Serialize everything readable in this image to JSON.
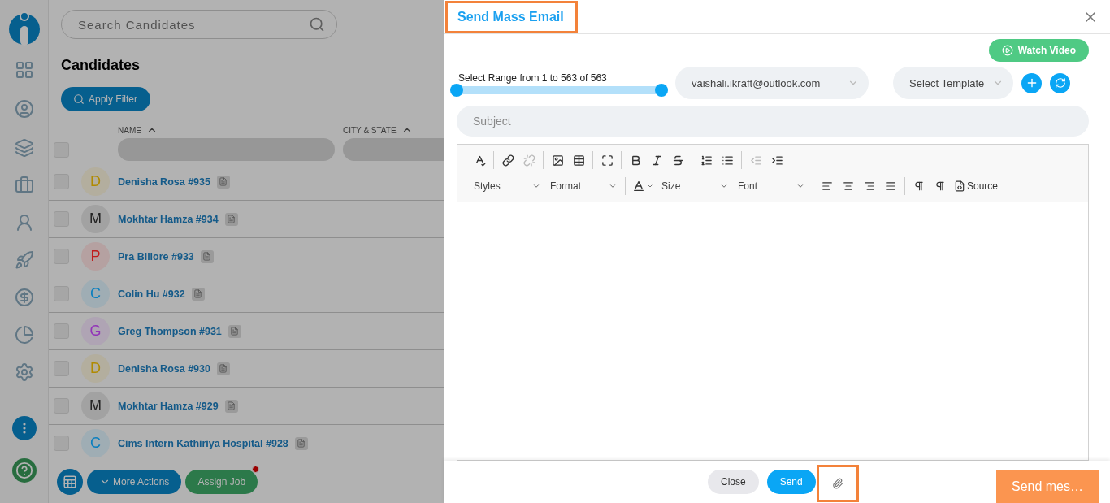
{
  "search": {
    "placeholder": "Search Candidates"
  },
  "page_title": "Candidates",
  "filter_button": "Apply Filter",
  "table": {
    "columns": [
      "NAME",
      "CITY & STATE"
    ],
    "select_all": {
      "checked": false
    },
    "rows": [
      {
        "initial": "D",
        "name": "Denisha Rosa #935",
        "color": "#b08a00",
        "checked": false
      },
      {
        "initial": "M",
        "name": "Mokhtar Hamza #934",
        "color": "#222222",
        "checked": false
      },
      {
        "initial": "P",
        "name": "Pra Billore #933",
        "color": "#c01d1d",
        "checked": false
      },
      {
        "initial": "C",
        "name": "Colin Hu #932",
        "color": "#0a7fbf",
        "checked": false
      },
      {
        "initial": "G",
        "name": "Greg Thompson #931",
        "color": "#9233b8",
        "checked": false
      },
      {
        "initial": "D",
        "name": "Denisha Rosa #930",
        "color": "#b08a00",
        "checked": false
      },
      {
        "initial": "M",
        "name": "Mokhtar Hamza #929",
        "color": "#222222",
        "checked": false
      },
      {
        "initial": "C",
        "name": "Cims Intern Kathiriya Hospital #928",
        "color": "#0a7fbf",
        "checked": false
      }
    ]
  },
  "action_bar": {
    "more_actions": "More Actions",
    "assign_job": "Assign Job"
  },
  "modal": {
    "title": "Send Mass Email",
    "title_highlighted": true,
    "watch_video": "Watch Video",
    "range_label": "Select Range from 1 to 563 of 563",
    "range": {
      "level": 1
    },
    "sender": "vaishali.ikraft@outlook.com",
    "template": {
      "placeholder": "Select Template"
    },
    "subject": {
      "placeholder": "Subject"
    },
    "toolbar_row_1": [
      [
        {
          "kind": "spellcheck",
          "disabled": false
        }
      ],
      [
        {
          "kind": "link",
          "disabled": false
        },
        {
          "kind": "unlink",
          "disabled": true
        }
      ],
      [
        {
          "kind": "image",
          "disabled": false
        },
        {
          "kind": "table",
          "disabled": false
        }
      ],
      [
        {
          "kind": "maximize",
          "disabled": false
        }
      ],
      [
        {
          "kind": "bold",
          "disabled": false
        },
        {
          "kind": "italic",
          "disabled": false
        },
        {
          "kind": "strike",
          "disabled": false
        }
      ],
      [
        {
          "kind": "ordered-list",
          "disabled": false
        },
        {
          "kind": "bullet-list",
          "disabled": false
        }
      ],
      [
        {
          "kind": "outdent",
          "disabled": true
        },
        {
          "kind": "indent",
          "disabled": false
        }
      ]
    ],
    "toolbar_row_2": [
      [
        {
          "kind": "dropdown",
          "label": "Styles"
        },
        {
          "kind": "dropdown",
          "label": "Format"
        }
      ],
      [
        {
          "kind": "text-color"
        },
        {
          "kind": "dropdown",
          "label": "Size"
        },
        {
          "kind": "dropdown",
          "label": "Font"
        }
      ],
      [
        {
          "kind": "align-left"
        },
        {
          "kind": "align-center"
        },
        {
          "kind": "align-right"
        },
        {
          "kind": "justify"
        }
      ],
      [
        {
          "kind": "ltr"
        },
        {
          "kind": "rtl"
        },
        {
          "kind": "source",
          "label": "Source"
        }
      ]
    ],
    "close_button": "Close",
    "send_button": "Send",
    "attach_highlighted": true
  },
  "callout": "Send mes…"
}
